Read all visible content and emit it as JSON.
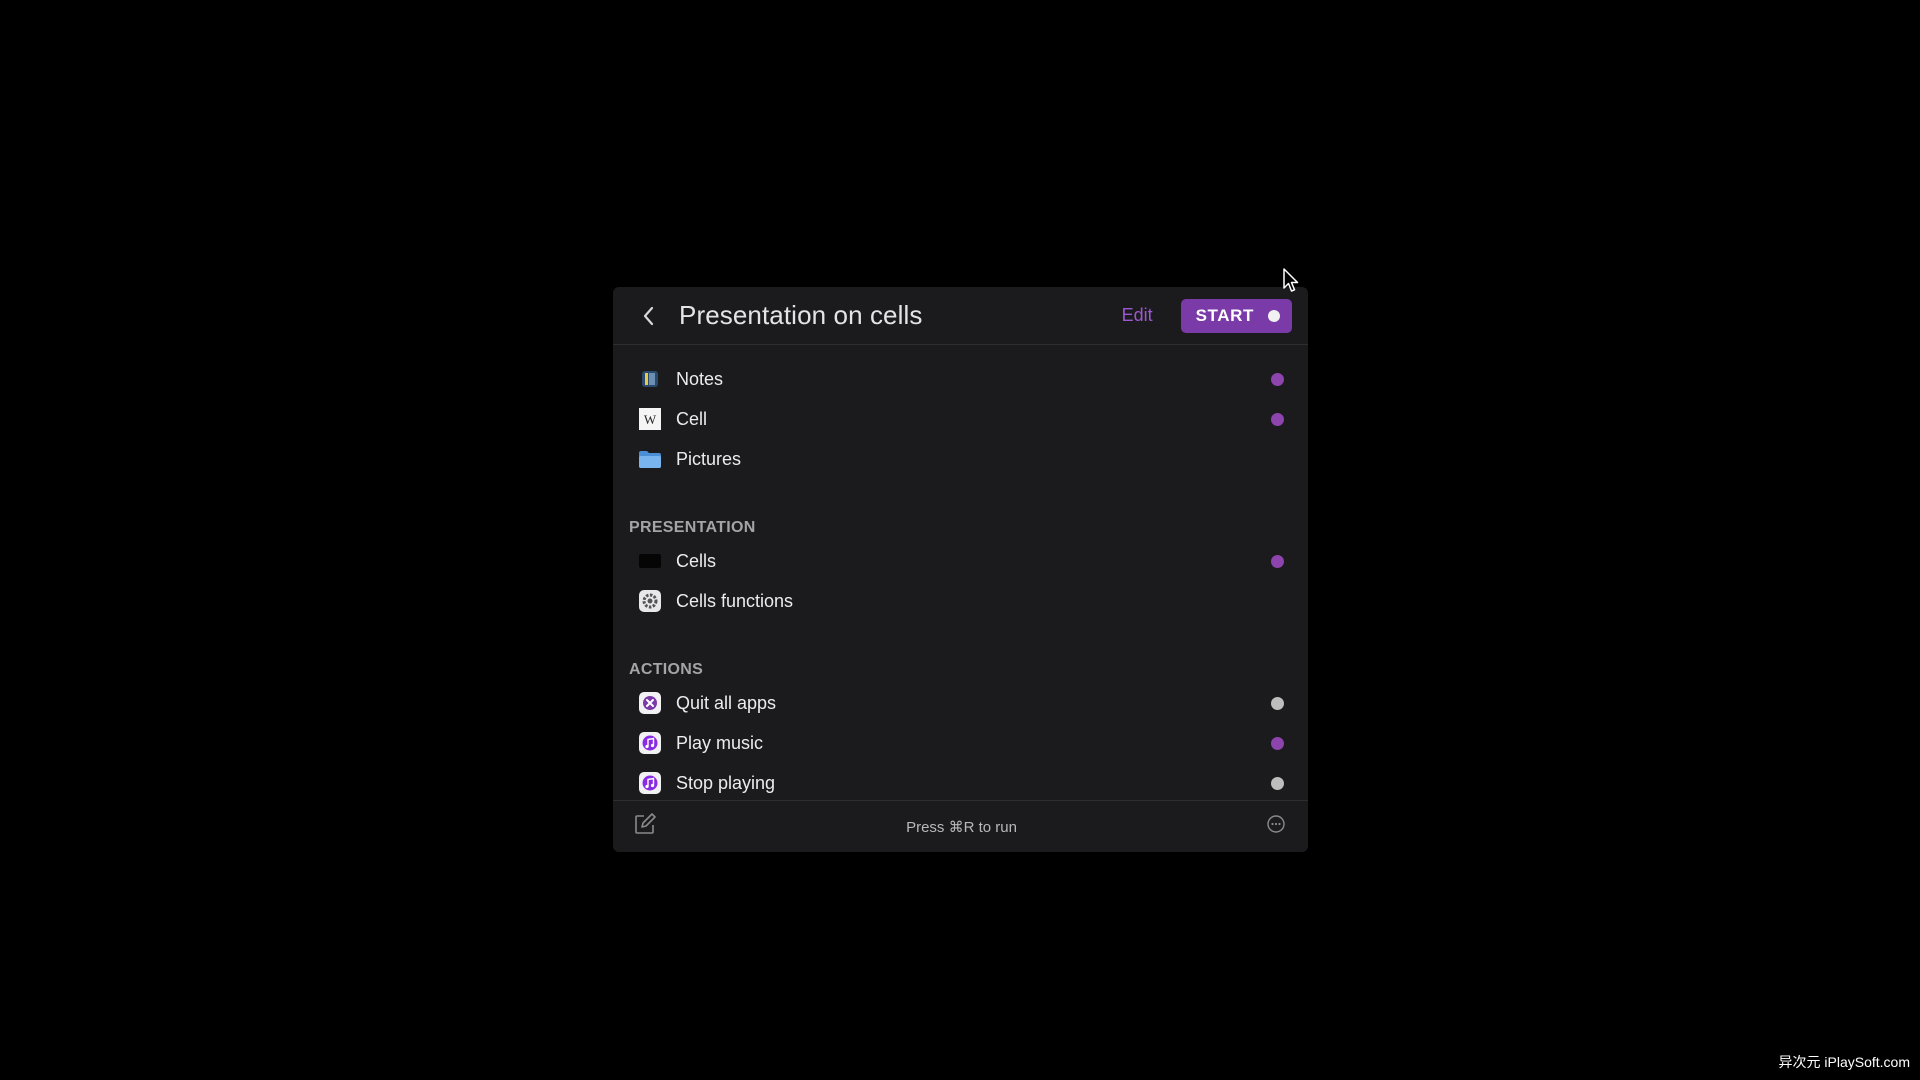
{
  "header": {
    "title": "Presentation on cells",
    "edit_label": "Edit",
    "start_label": "START"
  },
  "groups": [
    {
      "title": "",
      "items": [
        {
          "label": "Notes",
          "icon": "notes-icon",
          "status": "#8e44ad"
        },
        {
          "label": "Cell",
          "icon": "wikipedia-icon",
          "status": "#8e44ad"
        },
        {
          "label": "Pictures",
          "icon": "folder-icon",
          "status": ""
        }
      ]
    },
    {
      "title": "PRESENTATION",
      "items": [
        {
          "label": "Cells",
          "icon": "document-icon",
          "status": "#8e44ad"
        },
        {
          "label": "Cells functions",
          "icon": "gear-icon",
          "status": ""
        }
      ]
    },
    {
      "title": "ACTIONS",
      "items": [
        {
          "label": "Quit all apps",
          "icon": "quit-icon",
          "status": "#bdbdbd"
        },
        {
          "label": "Play music",
          "icon": "music-icon",
          "status": "#8e44ad"
        },
        {
          "label": "Stop playing",
          "icon": "music-icon",
          "status": "#bdbdbd"
        }
      ]
    }
  ],
  "footer": {
    "hint": "Press ⌘R to run"
  },
  "watermark": "异次元 iPlaySoft.com",
  "colors": {
    "accent": "#7a3aa8",
    "dot_active": "#8e44ad",
    "dot_inactive": "#bdbdbd"
  }
}
